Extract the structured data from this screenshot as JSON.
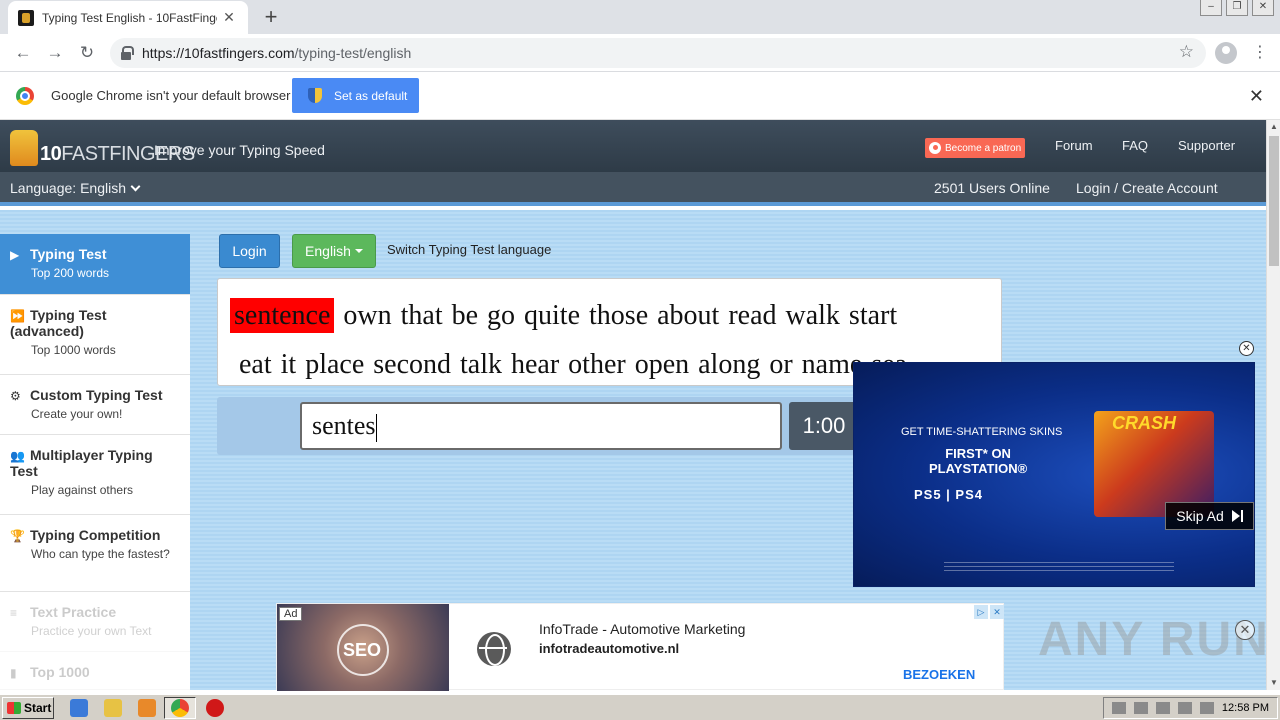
{
  "browser": {
    "tab_title": "Typing Test English - 10FastFingers.",
    "tab_close": "✕",
    "new_tab": "+",
    "url_host": "https://10fastfingers.com",
    "url_path": "/typing-test/english",
    "win_controls": [
      "–",
      "❐",
      "✕"
    ]
  },
  "infobar": {
    "message": "Google Chrome isn't your default browser",
    "button": "Set as default",
    "close": "✕"
  },
  "site": {
    "logo_part1": "10",
    "logo_part2": "FASTFINGERS",
    "tagline": "Improve your Typing Speed",
    "patron": "Become a patron",
    "nav": [
      "Forum",
      "FAQ",
      "Supporter"
    ],
    "language_label": "Language: English",
    "users_online": "2501 Users Online",
    "login_link": "Login / Create Account"
  },
  "sidebar": {
    "items": [
      {
        "title": "Typing Test",
        "sub": "Top 200 words",
        "icon": "▶"
      },
      {
        "title": "Typing Test (advanced)",
        "sub": "Top 1000 words",
        "icon": "⏩"
      },
      {
        "title": "Custom Typing Test",
        "sub": "Create your own!",
        "icon": "⚙"
      },
      {
        "title": "Multiplayer Typing Test",
        "sub": "Play against others",
        "icon": "👥"
      },
      {
        "title": "Typing Competition",
        "sub": "Who can type the fastest?",
        "icon": "🏆"
      },
      {
        "title": "Text Practice",
        "sub": "Practice your own Text",
        "icon": "≡"
      },
      {
        "title": "Top 1000",
        "sub": "",
        "icon": "▮"
      }
    ]
  },
  "test": {
    "login_button": "Login",
    "language_button": "English",
    "switch_text": "Switch Typing Test language",
    "current_word": "sentence",
    "line1_rest": "own that be go quite those about read walk start",
    "line2": "eat it place second talk hear other open along or name sea",
    "input_value": "sentes",
    "timer": "1:00"
  },
  "video_ad": {
    "line1": "GET TIME-SHATTERING SKINS",
    "line2a": "FIRST* ON",
    "line2b": "PLAYSTATION®",
    "line3": "PS5 | PS4",
    "game_title": "CRASH",
    "skip": "Skip Ad",
    "close": "✕"
  },
  "banner_ad": {
    "ad_tag": "Ad",
    "image_text": "SEO",
    "title": "InfoTrade - Automotive Marketing",
    "url": "infotradeautomotive.nl",
    "cta": "BEZOEKEN",
    "close": "✕",
    "watermark": "ANY RUN"
  },
  "taskbar": {
    "start": "Start",
    "clock": "12:58 PM"
  }
}
